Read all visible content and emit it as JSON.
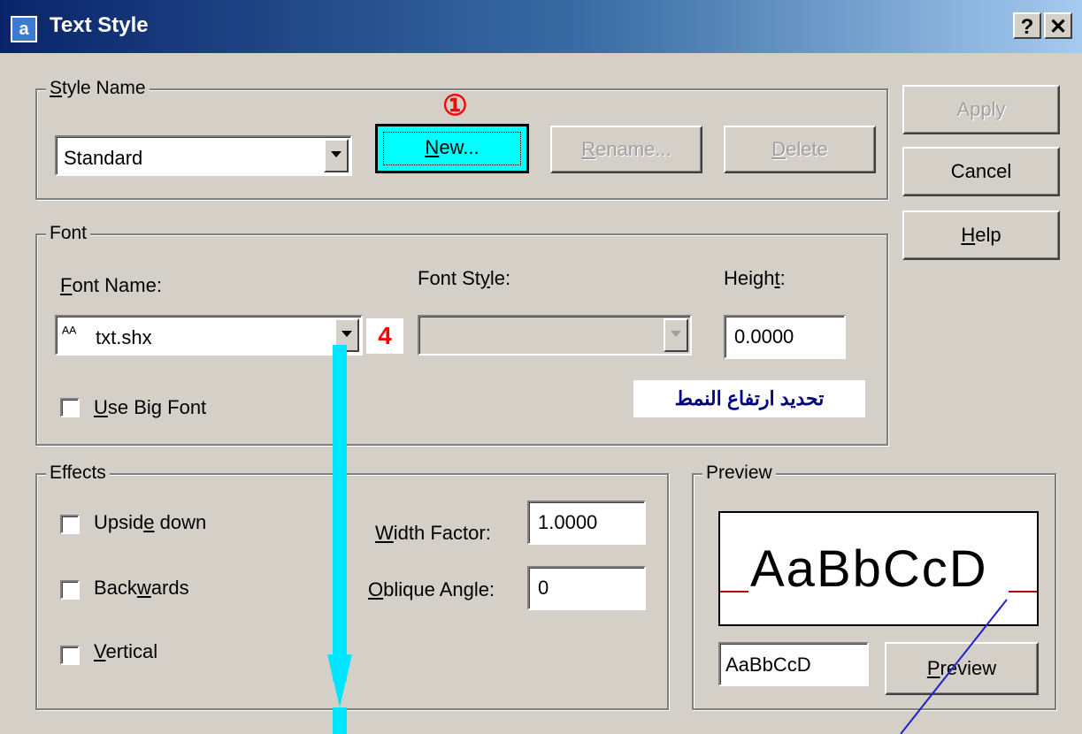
{
  "window": {
    "title": "Text Style",
    "help_button": "?",
    "close_button": "✕"
  },
  "style_name": {
    "group_label": "Style Name",
    "selected": "Standard",
    "new_label": "New...",
    "rename_label": "Rename...",
    "delete_label": "Delete",
    "step_marker": "①"
  },
  "side_buttons": {
    "apply": "Apply",
    "cancel": "Cancel",
    "help": "Help"
  },
  "font": {
    "group_label": "Font",
    "font_name_label": "Font Name:",
    "font_name_value": "txt.shx",
    "font_icon": "shx-font-icon",
    "step_marker": "4",
    "font_style_label": "Font Style:",
    "font_style_value": "",
    "height_label": "Height:",
    "height_value": "0.0000",
    "use_big_font_label": "Use Big Font",
    "use_big_font_checked": false,
    "arabic_note": "تحديد ارتفاع النمط"
  },
  "effects": {
    "group_label": "Effects",
    "upside_down_label": "Upside down",
    "backwards_label": "Backwards",
    "vertical_label": "Vertical",
    "upside_down_checked": false,
    "backwards_checked": false,
    "vertical_checked": false,
    "width_factor_label": "Width Factor:",
    "width_factor_value": "1.0000",
    "oblique_angle_label": "Oblique Angle:",
    "oblique_angle_value": "0"
  },
  "preview": {
    "group_label": "Preview",
    "sample_text": "AaBbCcD",
    "preview_display": "AaBbCcD",
    "preview_button": "Preview"
  },
  "colors": {
    "highlight": "#00ffff",
    "annotation_arrow": "#00e5ff",
    "marker": "#ff0000",
    "arabic_text": "#000080"
  }
}
